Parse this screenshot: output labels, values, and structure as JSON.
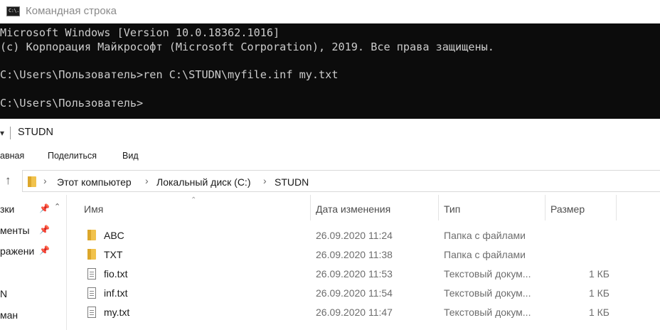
{
  "console": {
    "title": "Командная строка",
    "icon_text": "C:\\.",
    "lines": [
      "Microsoft Windows [Version 10.0.18362.1016]",
      "(c) Корпорация Майкрософт (Microsoft Corporation), 2019. Все права защищены.",
      "",
      "C:\\Users\\Пользователь>ren C:\\STUDN\\myfile.inf my.txt",
      "",
      "C:\\Users\\Пользователь>"
    ]
  },
  "explorer": {
    "title": "STUDN",
    "ribbon_tabs": [
      "авная",
      "Поделиться",
      "Вид"
    ],
    "breadcrumb": [
      "Этот компьютер",
      "Локальный диск (C:)",
      "STUDN"
    ],
    "nav_items": [
      "зки",
      "менты",
      "ражени",
      "",
      "N",
      "ман"
    ],
    "columns": {
      "name": "Имя",
      "date": "Дата изменения",
      "type": "Тип",
      "size": "Размер"
    },
    "files": [
      {
        "name": "ABC",
        "date": "26.09.2020 11:24",
        "type": "Папка с файлами",
        "size": "",
        "icon": "folder-icon"
      },
      {
        "name": "TXT",
        "date": "26.09.2020 11:38",
        "type": "Папка с файлами",
        "size": "",
        "icon": "folder-icon"
      },
      {
        "name": "fio.txt",
        "date": "26.09.2020 11:53",
        "type": "Текстовый докум...",
        "size": "1 КБ",
        "icon": "text-file-icon"
      },
      {
        "name": "inf.txt",
        "date": "26.09.2020 11:54",
        "type": "Текстовый докум...",
        "size": "1 КБ",
        "icon": "text-file-icon"
      },
      {
        "name": "my.txt",
        "date": "26.09.2020 11:47",
        "type": "Текстовый докум...",
        "size": "1 КБ",
        "icon": "text-file-icon"
      }
    ]
  }
}
